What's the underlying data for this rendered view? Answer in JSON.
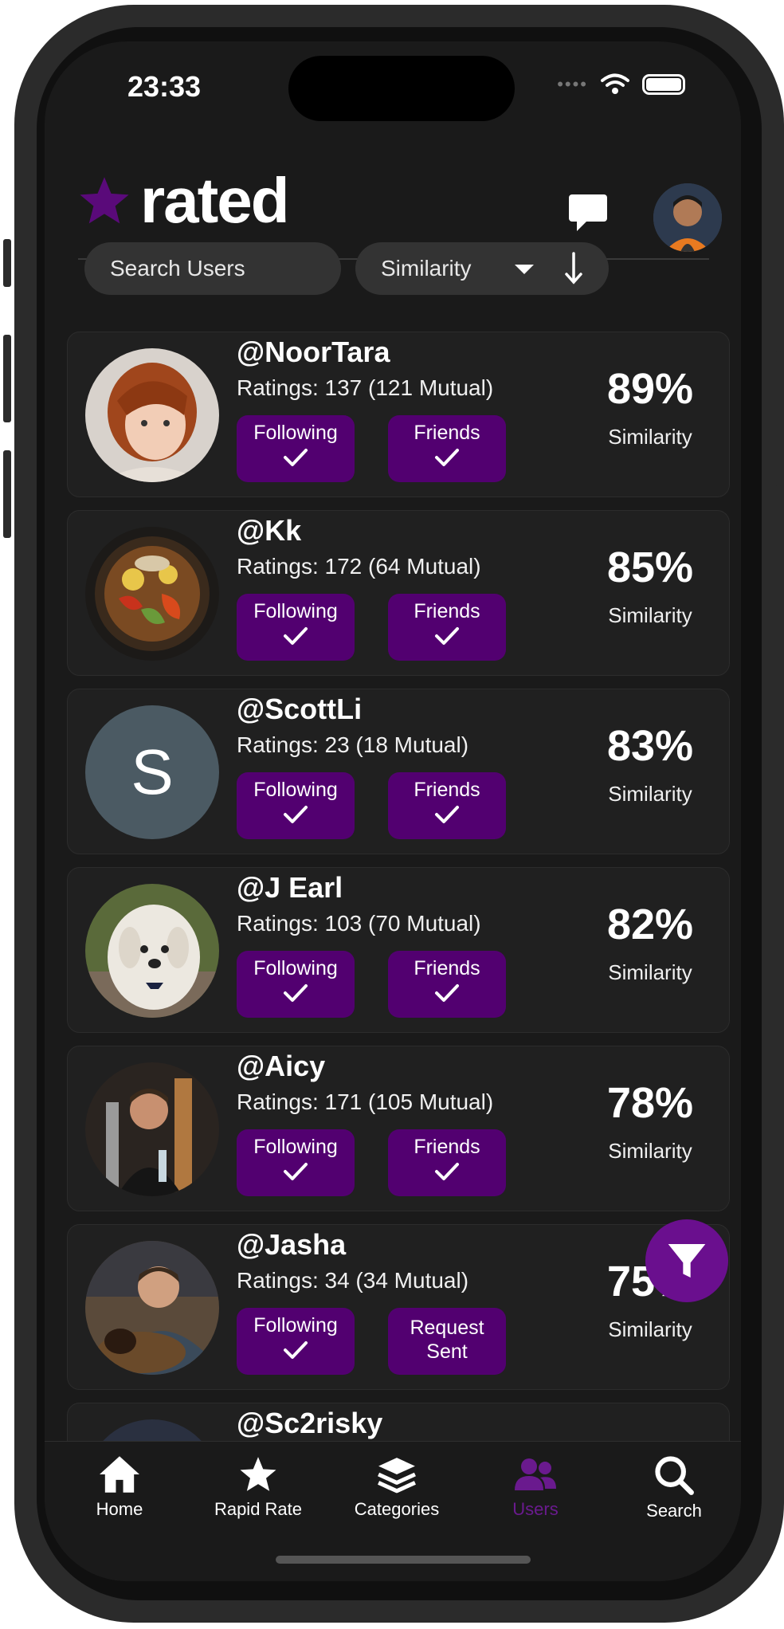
{
  "status_bar": {
    "time": "23:33"
  },
  "header": {
    "logo_text": "rated"
  },
  "controls": {
    "search_placeholder": "Search Users",
    "sort_label": "Similarity"
  },
  "users": [
    {
      "handle": "@NoorTara",
      "ratings": "Ratings: 137 (121 Mutual)",
      "follow_label": "Following",
      "friend_label": "Friends",
      "similarity": "89%",
      "similarity_label": "Similarity"
    },
    {
      "handle": "@Kk",
      "ratings": "Ratings: 172 (64 Mutual)",
      "follow_label": "Following",
      "friend_label": "Friends",
      "similarity": "85%",
      "similarity_label": "Similarity"
    },
    {
      "handle": "@ScottLi",
      "ratings": "Ratings: 23 (18 Mutual)",
      "follow_label": "Following",
      "friend_label": "Friends",
      "similarity": "83%",
      "similarity_label": "Similarity",
      "avatar_letter": "S"
    },
    {
      "handle": "@J Earl",
      "ratings": "Ratings: 103 (70 Mutual)",
      "follow_label": "Following",
      "friend_label": "Friends",
      "similarity": "82%",
      "similarity_label": "Similarity"
    },
    {
      "handle": "@Aicy",
      "ratings": "Ratings: 171 (105 Mutual)",
      "follow_label": "Following",
      "friend_label": "Friends",
      "similarity": "78%",
      "similarity_label": "Similarity"
    },
    {
      "handle": "@Jasha",
      "ratings": "Ratings: 34 (34 Mutual)",
      "follow_label": "Following",
      "friend_label_1": "Request",
      "friend_label_2": "Sent",
      "similarity": "75%",
      "similarity_label": "Similarity"
    },
    {
      "handle": "@Sc2risky"
    }
  ],
  "nav": [
    {
      "label": "Home",
      "icon": "home-icon"
    },
    {
      "label": "Rapid Rate",
      "icon": "star-icon"
    },
    {
      "label": "Categories",
      "icon": "layers-icon"
    },
    {
      "label": "Users",
      "icon": "users-icon",
      "active": true
    },
    {
      "label": "Search",
      "icon": "search-icon"
    }
  ],
  "colors": {
    "accent": "#520070",
    "active_nav": "#6a1a8e",
    "logo_star": "#5a0a7a"
  }
}
